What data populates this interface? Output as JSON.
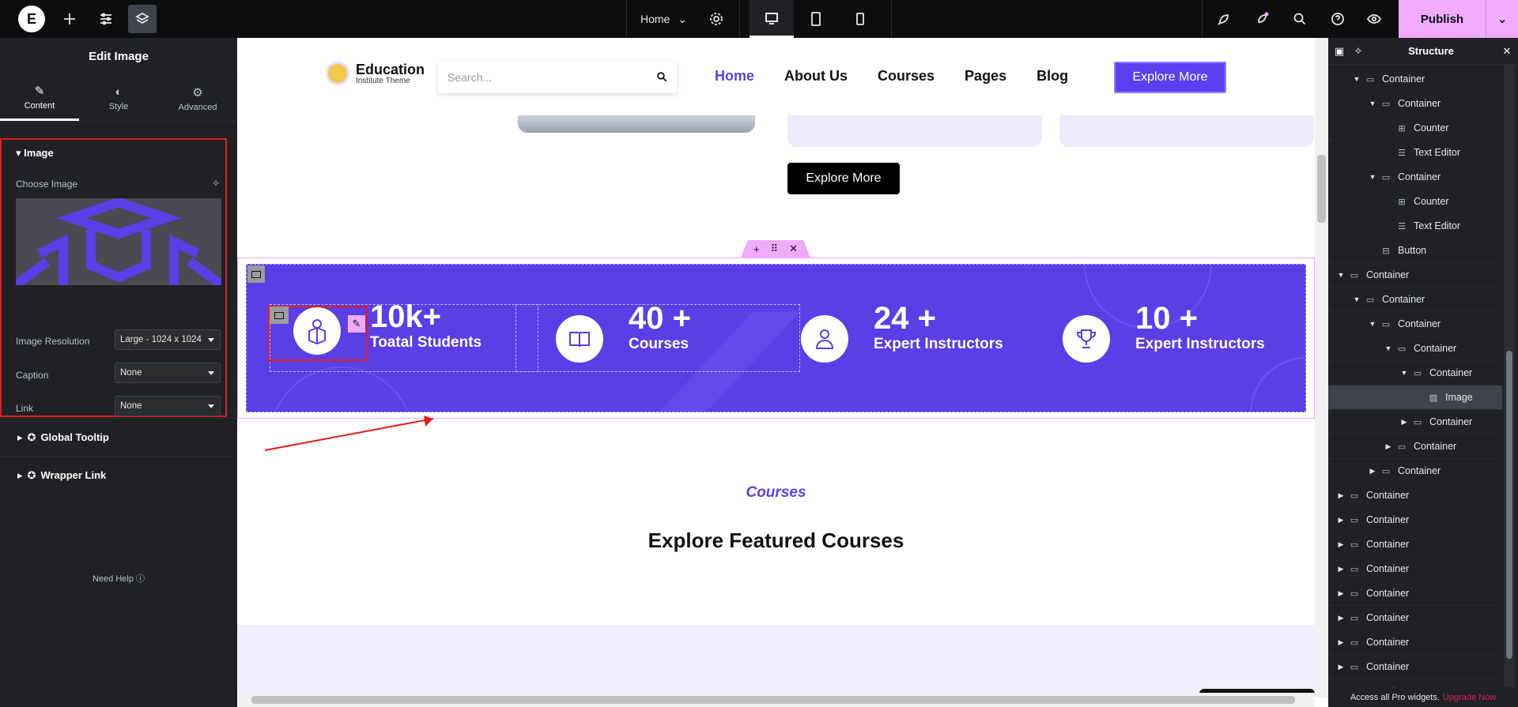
{
  "topbar": {
    "logo": "E",
    "page_name": "Home",
    "publish_label": "Publish"
  },
  "left_panel": {
    "title": "Edit Image",
    "tabs": [
      {
        "label": "Content",
        "icon": "pencil-icon"
      },
      {
        "label": "Style",
        "icon": "half-circle-icon"
      },
      {
        "label": "Advanced",
        "icon": "gear-icon"
      }
    ],
    "image_section": {
      "heading": "Image",
      "choose_image_label": "Choose Image",
      "resolution_label": "Image Resolution",
      "resolution_value": "Large - 1024 x 1024",
      "caption_label": "Caption",
      "caption_value": "None",
      "link_label": "Link",
      "link_value": "None"
    },
    "global_tooltip": "Global Tooltip",
    "wrapper_link": "Wrapper Link",
    "need_help": "Need Help"
  },
  "site": {
    "logo_name": "Education",
    "logo_sub": "Institute Theme",
    "search_placeholder": "Search...",
    "nav": [
      "Home",
      "About Us",
      "Courses",
      "Pages",
      "Blog"
    ],
    "nav_cta": "Explore More",
    "explore_more_dark": "Explore More",
    "stats": [
      {
        "number": "10k+",
        "label": "Toatal Students",
        "icon": "student-reading-icon"
      },
      {
        "number": "40 +",
        "label": "Courses",
        "icon": "open-book-icon"
      },
      {
        "number": "24 +",
        "label": "Expert Instructors",
        "icon": "instructor-icon"
      },
      {
        "number": "10 +",
        "label": "Expert Instructors",
        "icon": "trophy-icon"
      }
    ],
    "courses_label": "Courses",
    "courses_title": "Explore Featured Courses"
  },
  "structure_panel": {
    "title": "Structure",
    "rows": [
      {
        "label": "Container",
        "depth": 1,
        "arrow": "open",
        "type": "container"
      },
      {
        "label": "Container",
        "depth": 2,
        "arrow": "open",
        "type": "container"
      },
      {
        "label": "Counter",
        "depth": 3,
        "arrow": "none",
        "type": "counter"
      },
      {
        "label": "Text Editor",
        "depth": 3,
        "arrow": "none",
        "type": "text"
      },
      {
        "label": "Container",
        "depth": 2,
        "arrow": "open",
        "type": "container"
      },
      {
        "label": "Counter",
        "depth": 3,
        "arrow": "none",
        "type": "counter"
      },
      {
        "label": "Text Editor",
        "depth": 3,
        "arrow": "none",
        "type": "text"
      },
      {
        "label": "Button",
        "depth": 2,
        "arrow": "none",
        "type": "button"
      },
      {
        "label": "Container",
        "depth": 0,
        "arrow": "open",
        "type": "container"
      },
      {
        "label": "Container",
        "depth": 1,
        "arrow": "open",
        "type": "container"
      },
      {
        "label": "Container",
        "depth": 2,
        "arrow": "open",
        "type": "container"
      },
      {
        "label": "Container",
        "depth": 3,
        "arrow": "open",
        "type": "container"
      },
      {
        "label": "Container",
        "depth": 4,
        "arrow": "open",
        "type": "container"
      },
      {
        "label": "Image",
        "depth": 5,
        "arrow": "none",
        "type": "image",
        "selected": true
      },
      {
        "label": "Container",
        "depth": 4,
        "arrow": "closed",
        "type": "container"
      },
      {
        "label": "Container",
        "depth": 3,
        "arrow": "closed",
        "type": "container"
      },
      {
        "label": "Container",
        "depth": 2,
        "arrow": "closed",
        "type": "container"
      },
      {
        "label": "Container",
        "depth": 0,
        "arrow": "closed",
        "type": "container"
      },
      {
        "label": "Container",
        "depth": 0,
        "arrow": "closed",
        "type": "container"
      },
      {
        "label": "Container",
        "depth": 0,
        "arrow": "closed",
        "type": "container"
      },
      {
        "label": "Container",
        "depth": 0,
        "arrow": "closed",
        "type": "container"
      },
      {
        "label": "Container",
        "depth": 0,
        "arrow": "closed",
        "type": "container"
      },
      {
        "label": "Container",
        "depth": 0,
        "arrow": "closed",
        "type": "container"
      },
      {
        "label": "Container",
        "depth": 0,
        "arrow": "closed",
        "type": "container"
      },
      {
        "label": "Container",
        "depth": 0,
        "arrow": "closed",
        "type": "container"
      },
      {
        "label": "Container",
        "depth": 0,
        "arrow": "closed",
        "type": "container"
      }
    ],
    "footer_text": "Access all Pro widgets.",
    "footer_link": "Upgrade Now"
  },
  "colors": {
    "accent": "#5b3ff0",
    "editor_pink": "#f0abfc",
    "highlight_red": "#e01e1e"
  }
}
